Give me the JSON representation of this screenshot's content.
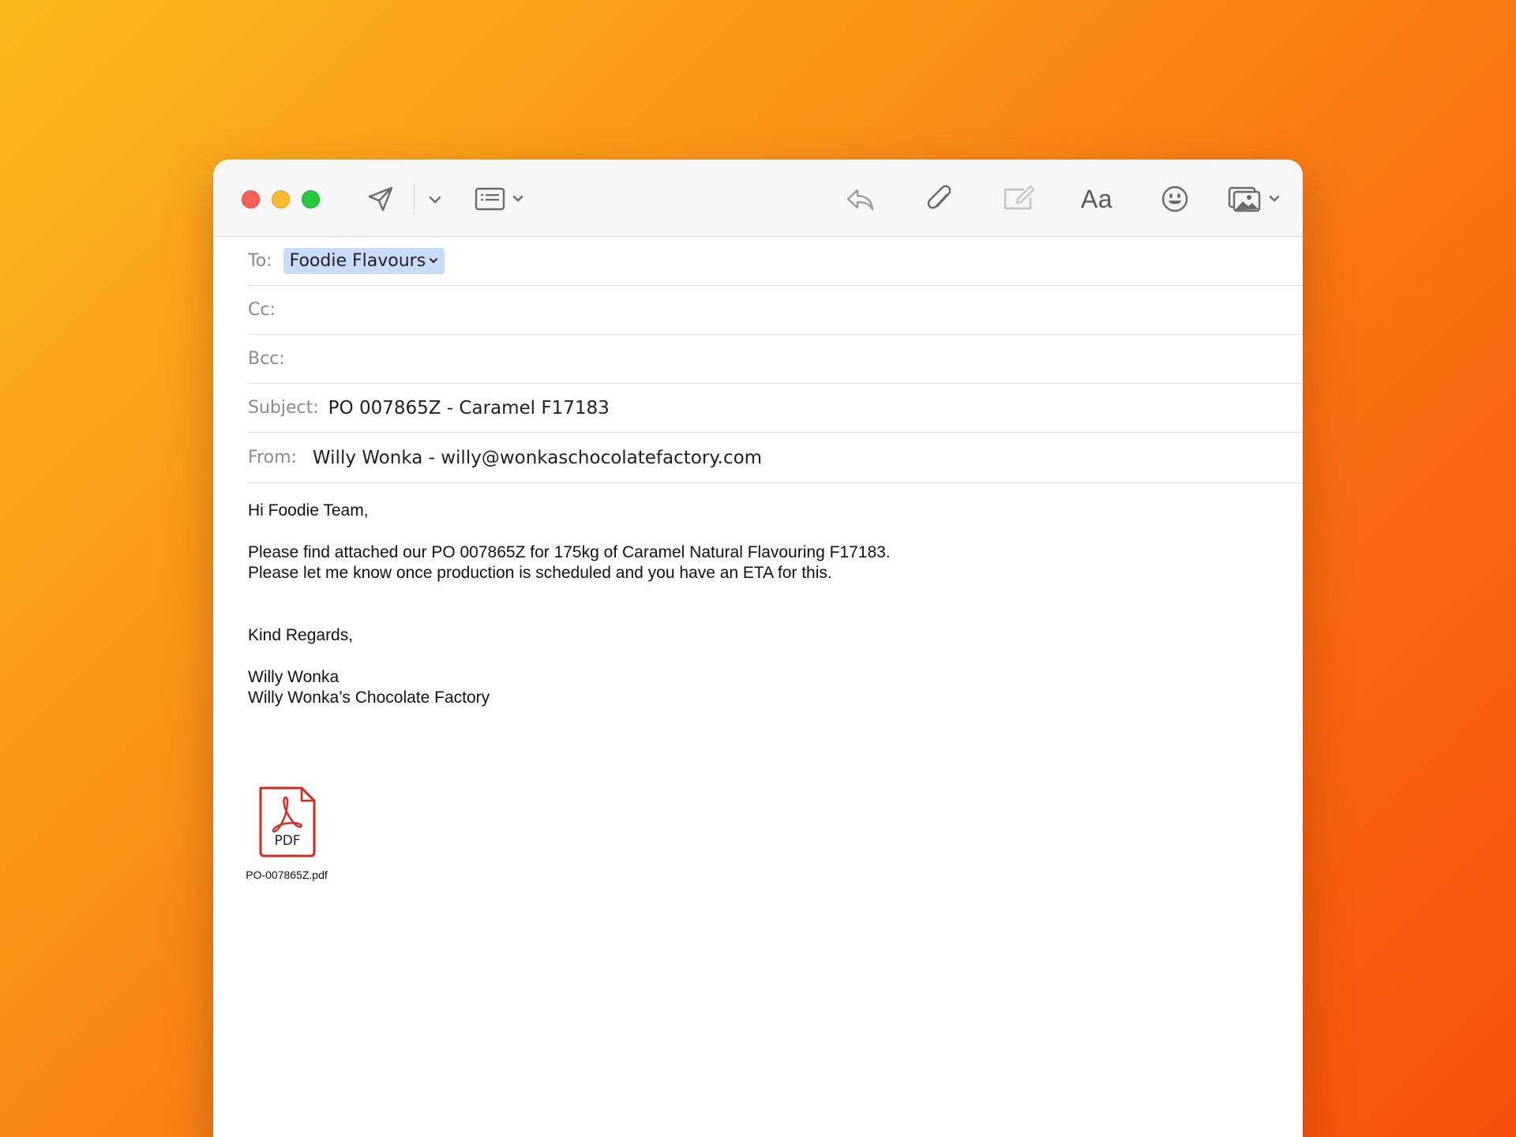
{
  "toolbar": {
    "icons": [
      "send-icon",
      "chevron-down-icon",
      "header-fields-icon",
      "reply-icon",
      "paperclip-icon",
      "markup-icon",
      "format-icon",
      "emoji-icon",
      "photo-browser-icon"
    ],
    "format_label": "Aa"
  },
  "header": {
    "to_label": "To:",
    "to_recipient": "Foodie Flavours",
    "cc_label": "Cc:",
    "bcc_label": "Bcc:",
    "subject_label": "Subject:",
    "subject_value": "PO 007865Z - Caramel F17183",
    "from_label": "From:",
    "from_value": "Willy Wonka - willy@wonkaschocolatefactory.com"
  },
  "body": {
    "greeting": "Hi Foodie Team,",
    "line1": "Please find attached our PO 007865Z for 175kg of Caramel Natural Flavouring F17183.",
    "line2": "Please let me know once production is scheduled and you have an ETA for this.",
    "closing": "Kind Regards,",
    "sig_name": "Willy Wonka",
    "sig_company": "Willy Wonka’s Chocolate Factory"
  },
  "attachment": {
    "type_label": "PDF",
    "filename": "PO-007865Z.pdf"
  },
  "colors": {
    "close": "#ff5f57",
    "minimize": "#febc2e",
    "maximize": "#28c840",
    "recipient_chip": "#c9dbf8",
    "pdf_red": "#d9291c"
  }
}
